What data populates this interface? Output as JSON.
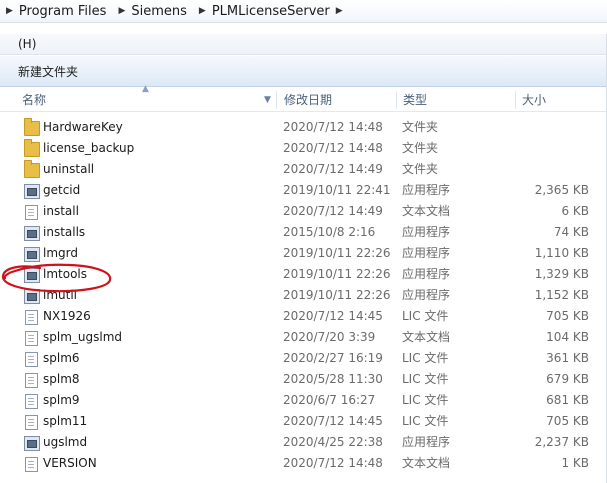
{
  "address_bar": {
    "crumbs": [
      "Program Files",
      "Siemens",
      "PLMLicenseServer"
    ]
  },
  "menu": {
    "partial_label": "(H)"
  },
  "toolbar": {
    "new_folder": "新建文件夹"
  },
  "columns": {
    "name": "名称",
    "date": "修改日期",
    "type": "类型",
    "size": "大小"
  },
  "files": [
    {
      "name": "HardwareKey",
      "date": "2020/7/12 14:48",
      "type": "文件夹",
      "size": "",
      "icon": "folder-icon"
    },
    {
      "name": "license_backup",
      "date": "2020/7/12 14:48",
      "type": "文件夹",
      "size": "",
      "icon": "folder-icon"
    },
    {
      "name": "uninstall",
      "date": "2020/7/12 14:49",
      "type": "文件夹",
      "size": "",
      "icon": "folder-icon"
    },
    {
      "name": "getcid",
      "date": "2019/10/11 22:41",
      "type": "应用程序",
      "size": "2,365 KB",
      "icon": "app-icon"
    },
    {
      "name": "install",
      "date": "2020/7/12 14:49",
      "type": "文本文档",
      "size": "6 KB",
      "icon": "doc-icon"
    },
    {
      "name": "installs",
      "date": "2015/10/8 2:16",
      "type": "应用程序",
      "size": "74 KB",
      "icon": "app-icon"
    },
    {
      "name": "lmgrd",
      "date": "2019/10/11 22:26",
      "type": "应用程序",
      "size": "1,110 KB",
      "icon": "app-icon"
    },
    {
      "name": "lmtools",
      "date": "2019/10/11 22:26",
      "type": "应用程序",
      "size": "1,329 KB",
      "icon": "app-icon"
    },
    {
      "name": "lmutil",
      "date": "2019/10/11 22:26",
      "type": "应用程序",
      "size": "1,152 KB",
      "icon": "app-icon"
    },
    {
      "name": "NX1926",
      "date": "2020/7/12 14:45",
      "type": "LIC 文件",
      "size": "705 KB",
      "icon": "doc-icon"
    },
    {
      "name": "splm_ugslmd",
      "date": "2020/7/20 3:39",
      "type": "文本文档",
      "size": "104 KB",
      "icon": "doc-icon"
    },
    {
      "name": "splm6",
      "date": "2020/2/27 16:19",
      "type": "LIC 文件",
      "size": "361 KB",
      "icon": "doc-icon"
    },
    {
      "name": "splm8",
      "date": "2020/5/28 11:30",
      "type": "LIC 文件",
      "size": "679 KB",
      "icon": "doc-icon"
    },
    {
      "name": "splm9",
      "date": "2020/6/7 16:27",
      "type": "LIC 文件",
      "size": "681 KB",
      "icon": "doc-icon"
    },
    {
      "name": "splm11",
      "date": "2020/7/12 14:45",
      "type": "LIC 文件",
      "size": "705 KB",
      "icon": "doc-icon"
    },
    {
      "name": "ugslmd",
      "date": "2020/4/25 22:38",
      "type": "应用程序",
      "size": "2,237 KB",
      "icon": "app-icon"
    },
    {
      "name": "VERSION",
      "date": "2020/7/12 14:48",
      "type": "文本文档",
      "size": "1 KB",
      "icon": "doc-icon"
    }
  ],
  "annotation_color": "#d0121b"
}
